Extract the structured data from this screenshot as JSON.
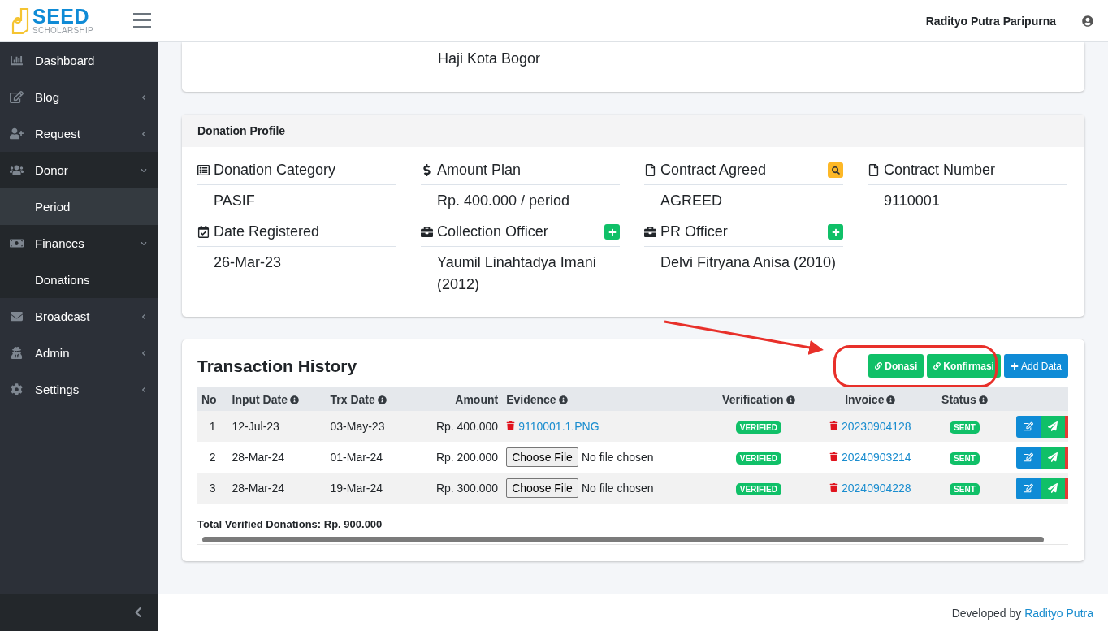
{
  "header": {
    "brand": "SEED",
    "brand_sub": "SCHOLARSHIP",
    "user": "Radityo Putra Paripurna"
  },
  "sidebar": {
    "items": [
      {
        "label": "Dashboard",
        "kind": "link",
        "expanded": false
      },
      {
        "label": "Blog",
        "kind": "menu",
        "expanded": false
      },
      {
        "label": "Request",
        "kind": "menu",
        "expanded": false
      },
      {
        "label": "Donor",
        "kind": "menu",
        "expanded": true,
        "children": [
          {
            "label": "Period",
            "selected": true
          }
        ]
      },
      {
        "label": "Finances",
        "kind": "menu",
        "expanded": true,
        "children": [
          {
            "label": "Donations",
            "selected": false
          }
        ]
      },
      {
        "label": "Broadcast",
        "kind": "menu",
        "expanded": false
      },
      {
        "label": "Admin",
        "kind": "menu",
        "expanded": false
      },
      {
        "label": "Settings",
        "kind": "menu",
        "expanded": false
      }
    ]
  },
  "address_card": {
    "lines": [
      "Haji Kota Bogor"
    ]
  },
  "donation_profile": {
    "title": "Donation Profile",
    "fields": [
      {
        "label": "Donation Category",
        "kind": "plain",
        "value": "PASIF"
      },
      {
        "label": "Amount Plan",
        "kind": "plain",
        "value": "Rp. 400.000 / period"
      },
      {
        "label": "Contract Agreed",
        "kind": "search",
        "value": "AGREED"
      },
      {
        "label": "Contract Number",
        "kind": "plain",
        "value": "9110001"
      },
      {
        "label": "Date Registered",
        "kind": "plain",
        "value": "26-Mar-23"
      },
      {
        "label": "Collection Officer",
        "kind": "add",
        "value": "Yaumil Linahtadya Imani (2012)"
      },
      {
        "label": "PR Officer",
        "kind": "add",
        "value": "Delvi Fitryana Anisa (2010)"
      }
    ]
  },
  "transaction_history": {
    "title": "Transaction History",
    "buttons": [
      {
        "label": "Donasi",
        "kind": "link"
      },
      {
        "label": "Konfirmasi",
        "kind": "link"
      },
      {
        "label": "Add Data",
        "kind": "add"
      }
    ],
    "columns": [
      {
        "label": "No",
        "info": false
      },
      {
        "label": "Input Date",
        "info": true
      },
      {
        "label": "Trx Date",
        "info": true
      },
      {
        "label": "Amount",
        "info": false
      },
      {
        "label": "Evidence",
        "info": true
      },
      {
        "label": "Verification",
        "info": true
      },
      {
        "label": "Invoice",
        "info": true
      },
      {
        "label": "Status",
        "info": true
      }
    ],
    "rows": [
      {
        "no": "1",
        "input_date": "12-Jul-23",
        "trx_date": "03-May-23",
        "amount": "Rp. 400.000",
        "evidence": {
          "kind": "link",
          "text": "9110001.1.PNG"
        },
        "verification": "VERIFIED",
        "invoice": "20230904128",
        "status": "SENT"
      },
      {
        "no": "2",
        "input_date": "28-Mar-24",
        "trx_date": "01-Mar-24",
        "amount": "Rp. 200.000",
        "evidence": {
          "kind": "file",
          "button": "Choose File",
          "text": "No file chosen"
        },
        "verification": "VERIFIED",
        "invoice": "20240903214",
        "status": "SENT"
      },
      {
        "no": "3",
        "input_date": "28-Mar-24",
        "trx_date": "19-Mar-24",
        "amount": "Rp. 300.000",
        "evidence": {
          "kind": "file",
          "button": "Choose File",
          "text": "No file chosen"
        },
        "verification": "VERIFIED",
        "invoice": "20240904228",
        "status": "SENT"
      }
    ],
    "total": "Total Verified Donations: Rp. 900.000"
  },
  "footer": {
    "text": "Developed by",
    "link": "Radityo Putra"
  }
}
